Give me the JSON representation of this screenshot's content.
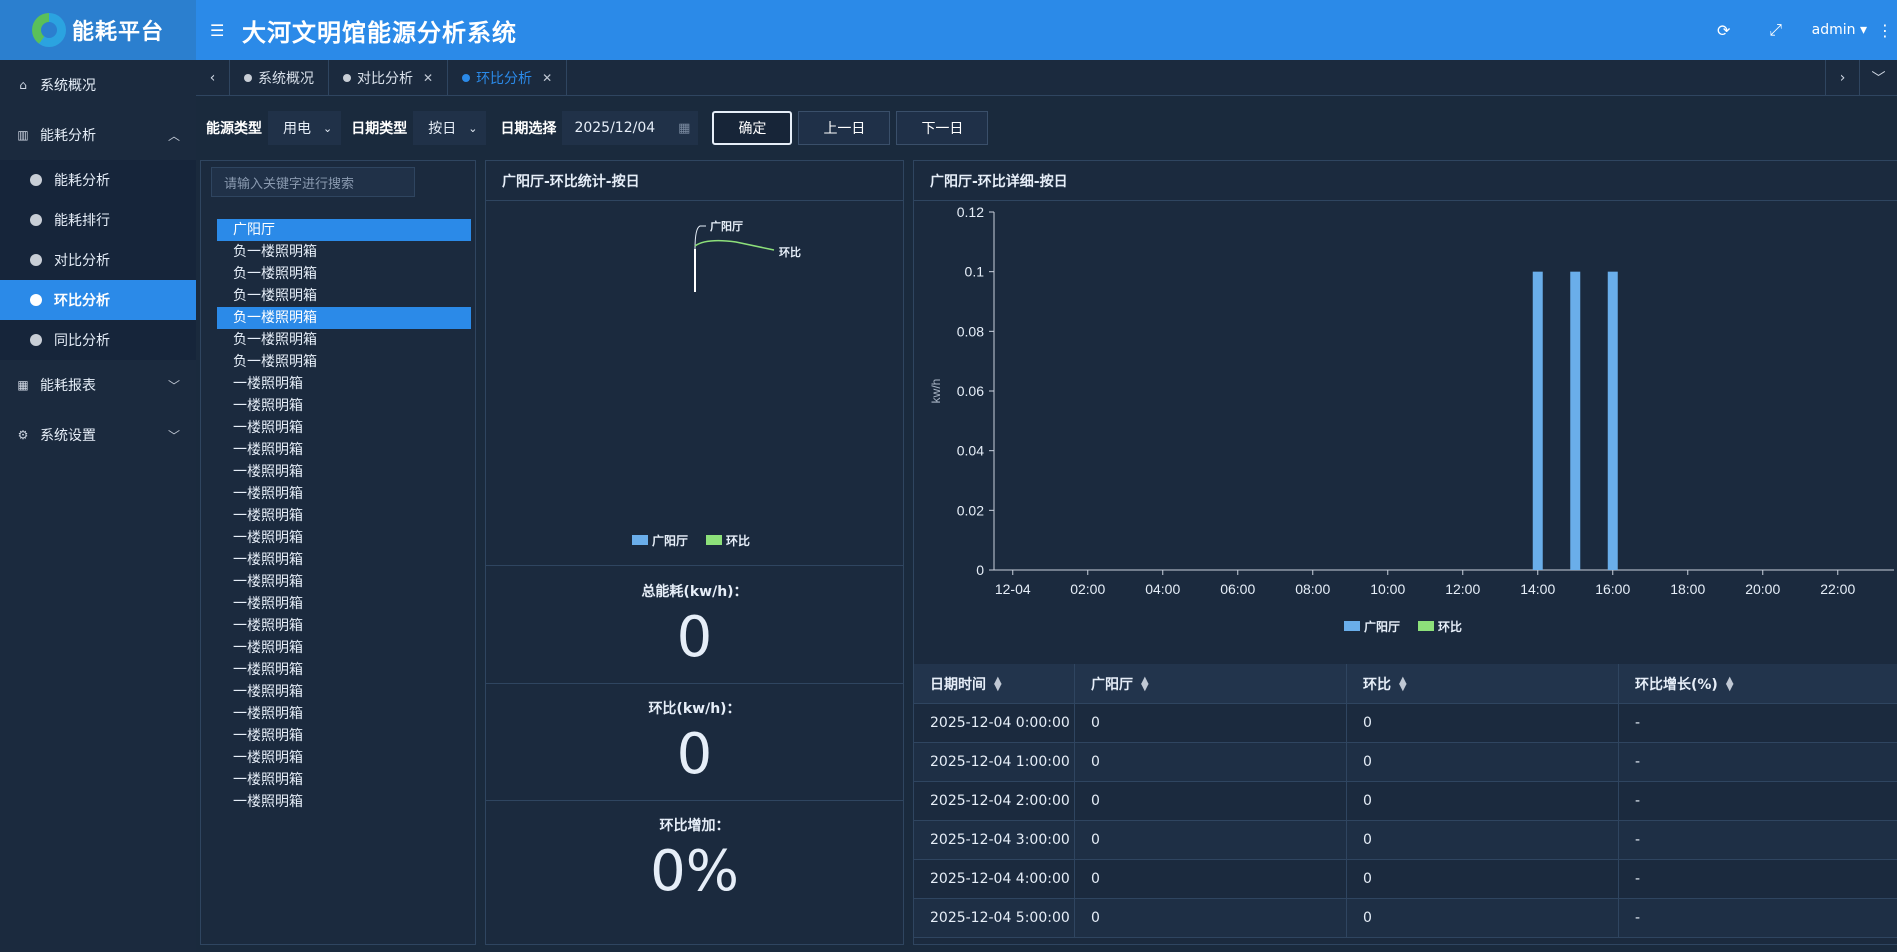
{
  "app": {
    "logo_text": "能耗平台",
    "title": "大河文明馆能源分析系统"
  },
  "header": {
    "user": "admin ▾"
  },
  "sidebar": {
    "items": [
      {
        "label": "系统概况",
        "icon": "home-icon"
      },
      {
        "label": "能耗分析",
        "icon": "bar-chart-icon"
      },
      {
        "label": "能耗报表",
        "icon": "table-icon"
      },
      {
        "label": "系统设置",
        "icon": "gear-icon"
      }
    ],
    "sub": [
      {
        "label": "能耗分析"
      },
      {
        "label": "能耗排行"
      },
      {
        "label": "对比分析"
      },
      {
        "label": "环比分析"
      },
      {
        "label": "同比分析"
      }
    ]
  },
  "tabs": [
    {
      "label": "系统概况"
    },
    {
      "label": "对比分析"
    },
    {
      "label": "环比分析"
    }
  ],
  "filter": {
    "energy_label": "能源类型",
    "energy_value": "用电",
    "date_type_label": "日期类型",
    "date_type_value": "按日",
    "date_label": "日期选择",
    "date_value": "2025/12/04",
    "confirm": "确定",
    "prev": "上一日",
    "next": "下一日"
  },
  "tree": {
    "placeholder": "请输入关键字进行搜索",
    "nodes": [
      "广阳厅",
      "负一楼照明箱",
      "负一楼照明箱",
      "负一楼照明箱",
      "负一楼照明箱",
      "负一楼照明箱",
      "负一楼照明箱",
      "一楼照明箱",
      "一楼照明箱",
      "一楼照明箱",
      "一楼照明箱",
      "一楼照明箱",
      "一楼照明箱",
      "一楼照明箱",
      "一楼照明箱",
      "一楼照明箱",
      "一楼照明箱",
      "一楼照明箱",
      "一楼照明箱",
      "一楼照明箱",
      "一楼照明箱",
      "一楼照明箱",
      "一楼照明箱",
      "一楼照明箱",
      "一楼照明箱",
      "一楼照明箱",
      "一楼照明箱"
    ]
  },
  "stats": {
    "title": "广阳厅-环比统计-按日",
    "pie_labels": {
      "a": "广阳厅",
      "b": "环比"
    },
    "legend": {
      "a": "广阳厅",
      "b": "环比"
    },
    "total_label": "总能耗(kw/h)：",
    "total_value": "0",
    "ratio_label": "环比(kw/h)：",
    "ratio_value": "0",
    "increase_label": "环比增加：",
    "increase_value": "0%"
  },
  "detail": {
    "title": "广阳厅-环比详细-按日",
    "legend": {
      "a": "广阳厅",
      "b": "环比"
    },
    "table": {
      "headers": [
        "日期时间",
        "广阳厅",
        "环比",
        "环比增长(%)"
      ],
      "rows": [
        [
          "2025-12-04 0:00:00",
          "0",
          "0",
          "-"
        ],
        [
          "2025-12-04 1:00:00",
          "0",
          "0",
          "-"
        ],
        [
          "2025-12-04 2:00:00",
          "0",
          "0",
          "-"
        ],
        [
          "2025-12-04 3:00:00",
          "0",
          "0",
          "-"
        ],
        [
          "2025-12-04 4:00:00",
          "0",
          "0",
          "-"
        ],
        [
          "2025-12-04 5:00:00",
          "0",
          "0",
          "-"
        ]
      ]
    }
  },
  "colors": {
    "accent": "#2b8ae8",
    "series_a": "#6aaeea",
    "series_b": "#8de07a"
  },
  "chart_data": {
    "type": "bar",
    "ylabel": "kw/h",
    "ylim": [
      0,
      0.12
    ],
    "y_ticks": [
      "0",
      "0.02",
      "0.04",
      "0.06",
      "0.08",
      "0.1",
      "0.12"
    ],
    "x_ticks": [
      "12-04",
      "02:00",
      "04:00",
      "06:00",
      "08:00",
      "10:00",
      "12:00",
      "14:00",
      "16:00",
      "18:00",
      "20:00",
      "22:00"
    ],
    "categories": [
      "00:00",
      "01:00",
      "02:00",
      "03:00",
      "04:00",
      "05:00",
      "06:00",
      "07:00",
      "08:00",
      "09:00",
      "10:00",
      "11:00",
      "12:00",
      "13:00",
      "14:00",
      "15:00",
      "16:00",
      "17:00",
      "18:00",
      "19:00",
      "20:00",
      "21:00",
      "22:00",
      "23:00"
    ],
    "series": [
      {
        "name": "广阳厅",
        "values": [
          0,
          0,
          0,
          0,
          0,
          0,
          0,
          0,
          0,
          0,
          0,
          0,
          0,
          0,
          0.1,
          0.1,
          0.1,
          0,
          0,
          0,
          0,
          0,
          0,
          0
        ]
      },
      {
        "name": "环比",
        "values": [
          0,
          0,
          0,
          0,
          0,
          0,
          0,
          0,
          0,
          0,
          0,
          0,
          0,
          0,
          0,
          0,
          0,
          0,
          0,
          0,
          0,
          0,
          0,
          0
        ]
      }
    ]
  }
}
